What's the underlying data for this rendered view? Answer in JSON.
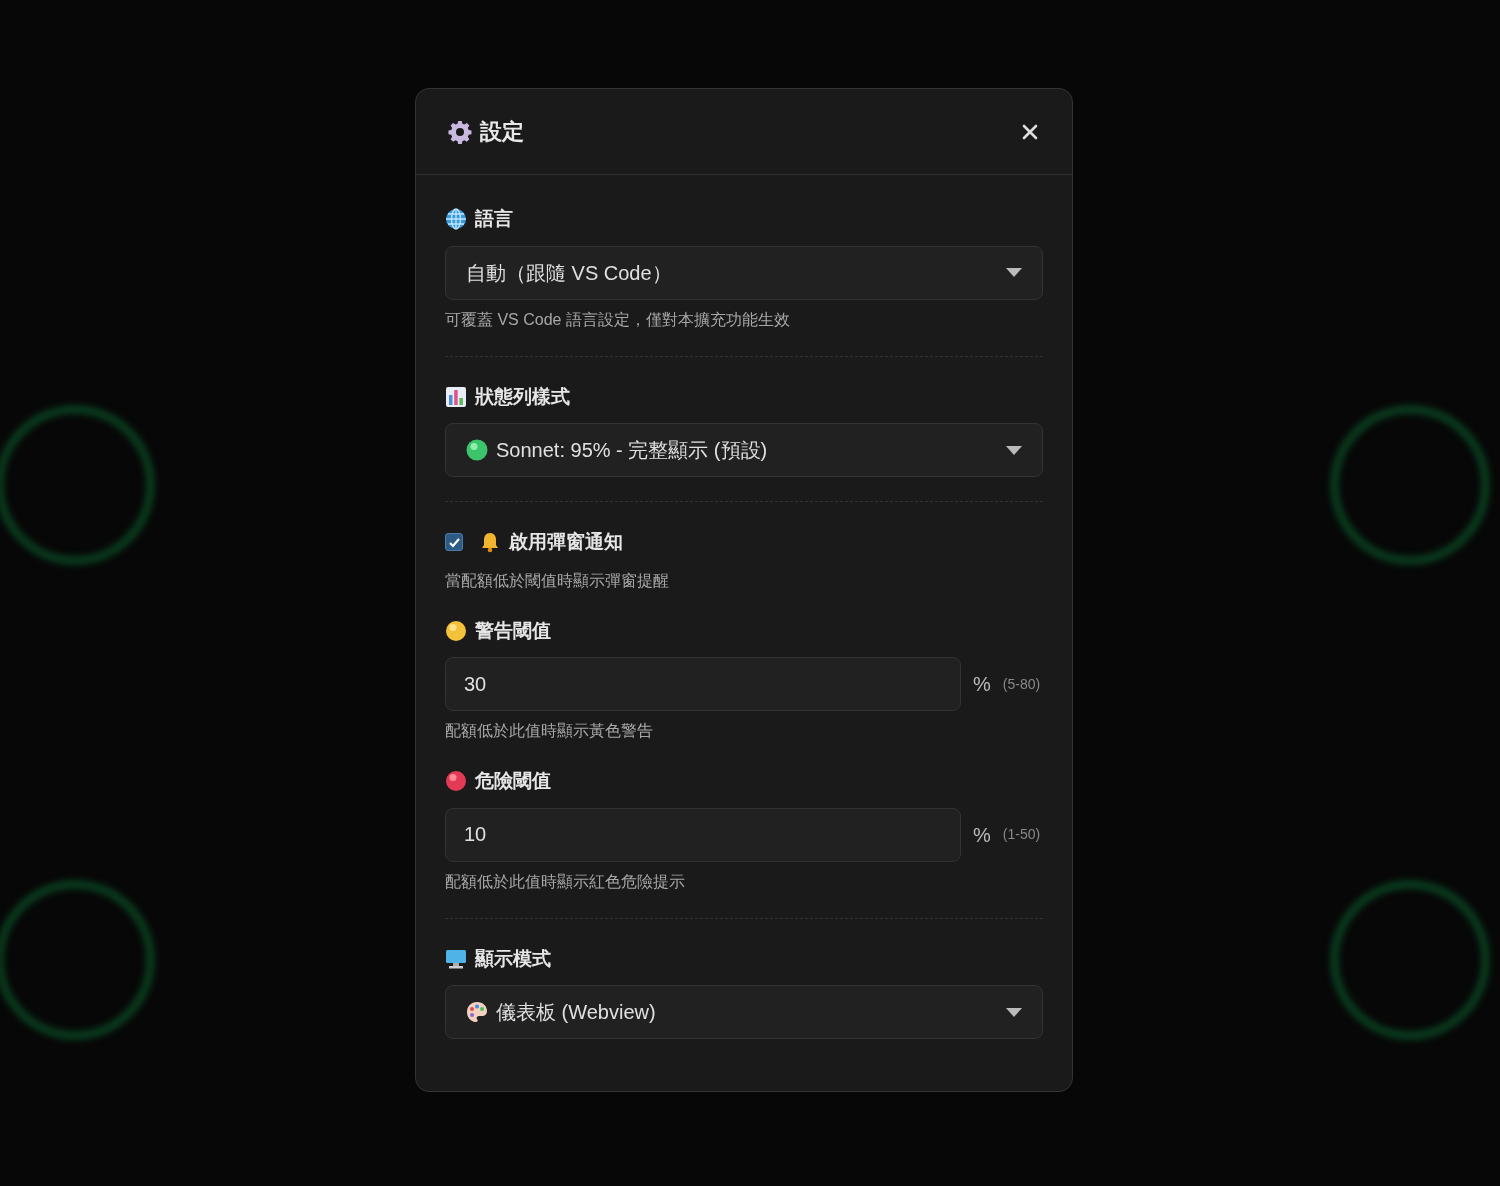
{
  "dialog": {
    "title": "設定",
    "groups": [
      [
        {
          "kind": "select",
          "label": "語言",
          "value": "自動（跟隨 VS Code）",
          "hint": "可覆蓋 VS Code 語言設定，僅對本擴充功能生效"
        }
      ],
      [
        {
          "kind": "select",
          "label": "狀態列樣式",
          "value": "Sonnet: 95% - 完整顯示 (預設)"
        }
      ],
      [
        {
          "kind": "checkbox",
          "label": "啟用彈窗通知",
          "checked": true,
          "hint": "當配額低於閾值時顯示彈窗提醒"
        },
        {
          "kind": "number",
          "label": "警告閾值",
          "value": "30",
          "unit": "%",
          "range": "(5-80)",
          "hint": "配額低於此值時顯示黃色警告"
        },
        {
          "kind": "number",
          "label": "危險閾值",
          "value": "10",
          "unit": "%",
          "range": "(1-50)",
          "hint": "配額低於此值時顯示紅色危險提示"
        }
      ],
      [
        {
          "kind": "select",
          "label": "顯示模式",
          "value": "儀表板 (Webview)"
        }
      ]
    ]
  }
}
